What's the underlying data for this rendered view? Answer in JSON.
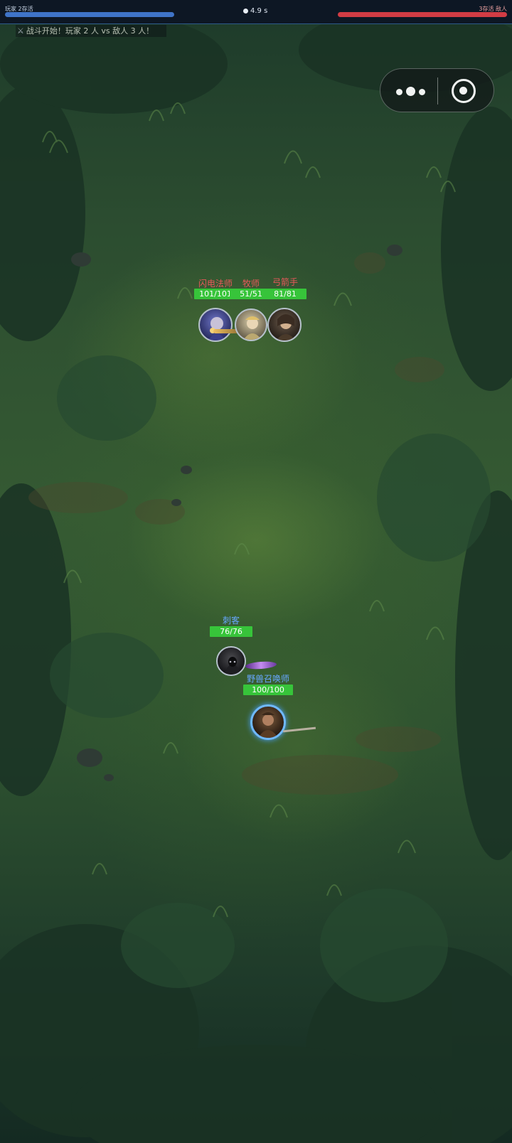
{
  "hud": {
    "player_side_label": "玩家 2存活",
    "enemy_side_label": "3存活 敌人",
    "timer": "4.9 s",
    "player_hp_fraction": 1.0,
    "enemy_hp_fraction": 1.0
  },
  "battle_log": "战斗开始！玩家 2 人 vs 敌人 3 人！",
  "enemies": [
    {
      "name": "闪电法师",
      "hp": "101/101"
    },
    {
      "name": "牧师",
      "hp": "51/51"
    },
    {
      "name": "弓箭手",
      "hp": "81/81"
    }
  ],
  "allies": [
    {
      "name": "刺客",
      "hp": "76/76"
    },
    {
      "name": "野兽召唤师",
      "hp": "100/100"
    }
  ],
  "icons": {
    "timer": "stopwatch-icon",
    "log": "crossed-swords-icon",
    "menu": "more-dots-icon",
    "close": "target-close-icon"
  }
}
